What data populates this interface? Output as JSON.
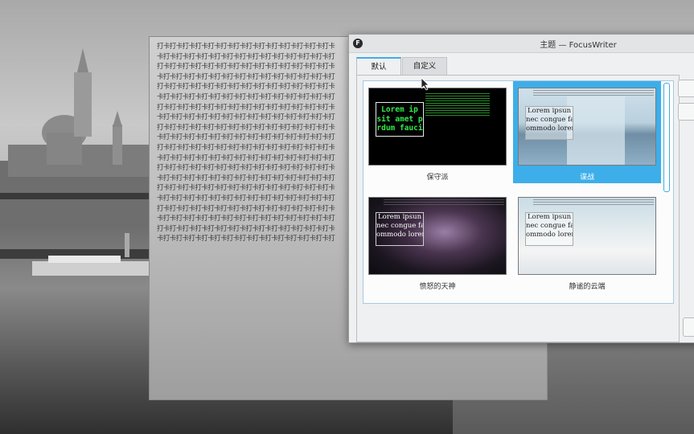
{
  "window": {
    "title": "主题 — FocusWriter",
    "app_icon": "F"
  },
  "tabs": [
    {
      "label": "默认"
    },
    {
      "label": "自定义"
    }
  ],
  "document": {
    "lines": [
      "打卡打卡打卡打卡打卡打卡打卡打卡打卡打卡打卡打卡打卡打卡",
      "卡打卡打卡打卡打卡打卡打卡打卡打卡打卡打卡打卡打卡打卡打",
      "打卡打卡打卡打卡打卡打卡打卡打卡打卡打卡打卡打卡打卡打卡",
      "卡打卡打卡打卡打卡打卡打卡打卡打卡打卡打卡打卡打卡打卡打",
      "打卡打卡打卡打卡打卡打卡打卡打卡打卡打卡打卡打卡打卡打卡",
      "卡打卡打卡打卡打卡打卡打卡打卡打卡打卡打卡打卡打卡打卡打",
      "打卡打卡打卡打卡打卡打卡打卡打卡打卡打卡打卡打卡打卡打卡",
      "卡打卡打卡打卡打卡打卡打卡打卡打卡打卡打卡打卡打卡打卡打",
      "打卡打卡打卡打卡打卡打卡打卡打卡打卡打卡打卡打卡打卡打卡",
      "卡打卡打卡打卡打卡打卡打卡打卡打卡打卡打卡打卡打卡打卡打",
      "打卡打卡打卡打卡打卡打卡打卡打卡打卡打卡打卡打卡打卡打卡",
      "卡打卡打卡打卡打卡打卡打卡打卡打卡打卡打卡打卡打卡打卡打",
      "打卡打卡打卡打卡打卡打卡打卡打卡打卡打卡打卡打卡打卡打卡",
      "卡打卡打卡打卡打卡打卡打卡打卡打卡打卡打卡打卡打卡打卡打",
      "打卡打卡打卡打卡打卡打卡打卡打卡打卡打卡打卡打卡打卡打卡",
      "卡打卡打卡打卡打卡打卡打卡打卡打卡打卡打卡打卡打卡打卡打",
      "打卡打卡打卡打卡打卡打卡打卡打卡打卡打卡打卡打卡打卡打卡",
      "卡打卡打卡打卡打卡打卡打卡打卡打卡打卡打卡打卡打卡打卡打",
      "打卡打卡打卡打卡打卡打卡打卡打卡打卡打卡打卡打卡打卡打卡",
      "卡打卡打卡打卡打卡打卡打卡打卡打卡打卡打卡打卡打卡打卡打"
    ]
  },
  "themes": [
    {
      "name": "保守派",
      "sample": "Lorem ip\nsit amet p\nrdum fauci",
      "selected": false
    },
    {
      "name": "谍战",
      "sample": "Lorem ipsun\nnec congue fac\nommodo lorem.",
      "selected": true
    },
    {
      "name": "愤怒的天神",
      "sample": "Lorem ipsun\nnec congue fac\nommodo lorem.",
      "selected": false
    },
    {
      "name": "静谧的云端",
      "sample": "Lorem ipsun\nnec congue fac\nommodo lorem.",
      "selected": false
    }
  ],
  "colors": {
    "accent": "#3daee9",
    "window_bg": "#eff0f1"
  }
}
